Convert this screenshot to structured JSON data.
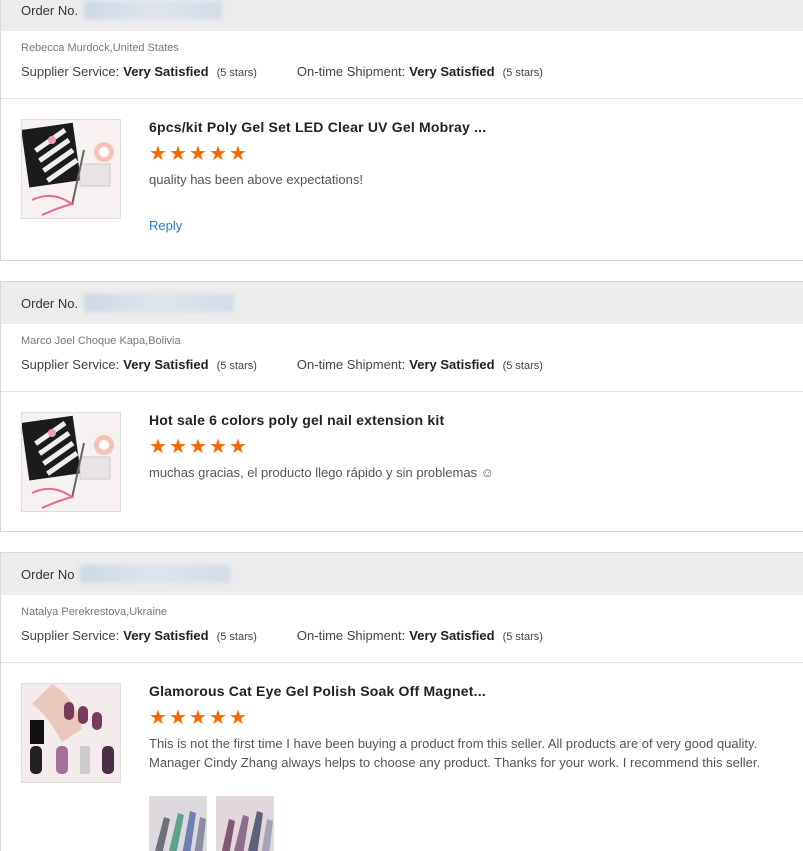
{
  "labels": {
    "supplier_service": "Supplier Service:",
    "shipment": "On-time Shipment:",
    "reply": "Reply"
  },
  "colors": {
    "star": "#f56a00",
    "link": "#2a7cc4",
    "header_bg": "#ececec"
  },
  "reviews": [
    {
      "order_label": "Order No.",
      "buyer": "Rebecca Murdock,United States",
      "supplier_value": "Very Satisfied",
      "supplier_stars": "(5 stars)",
      "shipment_value": "Very Satisfied",
      "shipment_stars": "(5 stars)",
      "product_title": "6pcs/kit Poly Gel Set LED Clear UV Gel Mobray ...",
      "rating": 5,
      "text": "quality has been above expectations!",
      "has_reply": true
    },
    {
      "order_label": "Order No.",
      "buyer": "Marco Joel Choque Kapa,Bolivia",
      "supplier_value": "Very Satisfied",
      "supplier_stars": "(5 stars)",
      "shipment_value": "Very Satisfied",
      "shipment_stars": "(5 stars)",
      "product_title": "Hot sale 6 colors poly gel nail extension kit",
      "rating": 5,
      "text": "muchas gracias, el producto llego rápido y sin problemas ☺"
    },
    {
      "order_label": "Order No",
      "buyer": "Natalya Perekrestova,Ukraine",
      "supplier_value": "Very Satisfied",
      "supplier_stars": "(5 stars)",
      "shipment_value": "Very Satisfied",
      "shipment_stars": "(5 stars)",
      "product_title": "Glamorous Cat Eye Gel Polish Soak Off Magnet...",
      "rating": 5,
      "text": "This is not the first time I have been buying a product from this seller. All products are of very good quality. Manager Cindy Zhang always helps to choose any product. Thanks for your work. I recommend this seller."
    }
  ]
}
